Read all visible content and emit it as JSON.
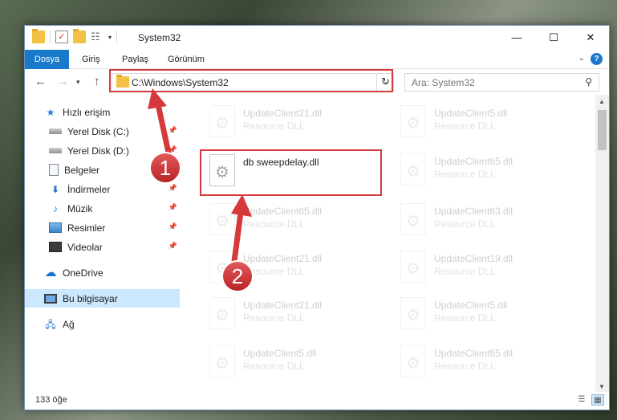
{
  "window": {
    "title": "System32",
    "controls": {
      "minimize": "—",
      "maximize": "☐",
      "close": "✕"
    }
  },
  "ribbon": {
    "tabs": [
      "Dosya",
      "Giriş",
      "Paylaş",
      "Görünüm"
    ],
    "help": "?"
  },
  "address": {
    "path": "C:\\Windows\\System32",
    "search_placeholder": "Ara: System32"
  },
  "sidebar": {
    "items": [
      {
        "label": "Hızlı erişim",
        "icon": "star-icon",
        "pinned": false
      },
      {
        "label": "Yerel Disk (C:)",
        "icon": "drive-icon",
        "pinned": true
      },
      {
        "label": "Yerel Disk (D:)",
        "icon": "drive-icon",
        "pinned": true
      },
      {
        "label": "Belgeler",
        "icon": "documents-icon",
        "pinned": true
      },
      {
        "label": "İndirmeler",
        "icon": "download-icon",
        "pinned": true
      },
      {
        "label": "Müzik",
        "icon": "music-icon",
        "pinned": true
      },
      {
        "label": "Resimler",
        "icon": "pictures-icon",
        "pinned": true
      },
      {
        "label": "Videolar",
        "icon": "video-icon",
        "pinned": true
      },
      {
        "label": "OneDrive",
        "icon": "cloud-icon",
        "pinned": false
      },
      {
        "label": "Bu bilgisayar",
        "icon": "computer-icon",
        "pinned": false,
        "selected": true
      },
      {
        "label": "Ağ",
        "icon": "network-icon",
        "pinned": false
      }
    ]
  },
  "files": {
    "highlighted": {
      "name": "db sweepdelay.dll",
      "type": ""
    },
    "left_column": [
      {
        "name": "UpdateClient21.dll",
        "type": "Resource DLL"
      },
      {
        "name": "UpdateClient65.dll",
        "type": "Resource DLL"
      },
      {
        "name": "UpdateClient21.dll",
        "type": "Resource DLL"
      },
      {
        "name": "UpdateClient21.dll",
        "type": "Resource DLL"
      },
      {
        "name": "UpdateClient5.dll",
        "type": "Resource DLL"
      }
    ],
    "right_column": [
      {
        "name": "UpdateClient5.dll",
        "type": "Resource DLL"
      },
      {
        "name": "UpdateClient65.dll",
        "type": "Resource DLL"
      },
      {
        "name": "UpdateClient63.dll",
        "type": "Resource DLL"
      },
      {
        "name": "UpdateClient19.dll",
        "type": "Resource DLL"
      },
      {
        "name": "UpdateClient5.dll",
        "type": "Resource DLL"
      },
      {
        "name": "UpdateClient65.dll",
        "type": "Resource DLL"
      }
    ]
  },
  "status": {
    "count": "133 öğe"
  },
  "annotations": {
    "step1": "1",
    "step2": "2",
    "color": "#d5393b"
  }
}
